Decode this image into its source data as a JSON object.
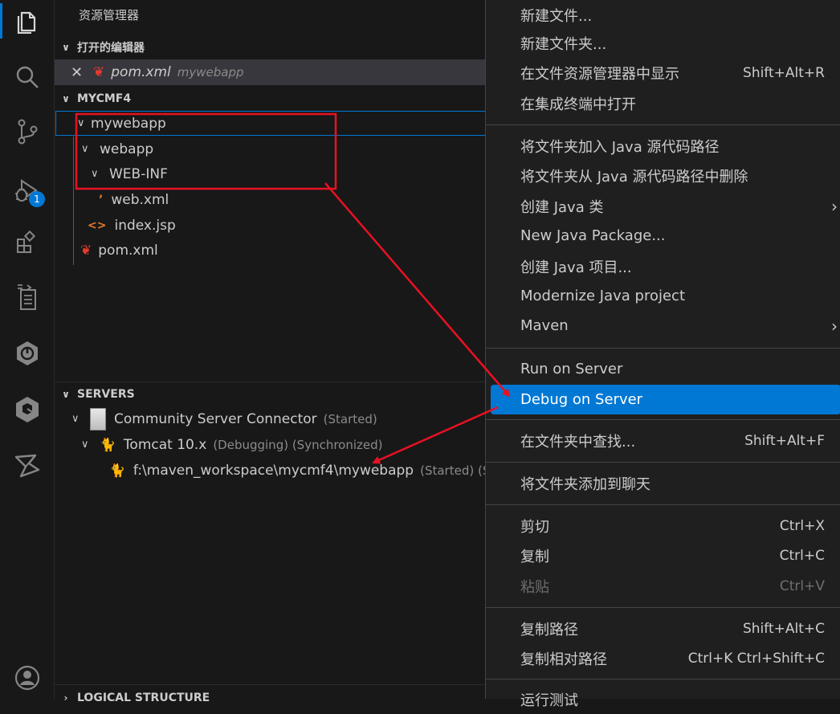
{
  "explorer_title": "资源管理器",
  "open_editors": {
    "header": "打开的编辑器",
    "item_name": "pom.xml",
    "item_folder": "mywebapp"
  },
  "workspace": {
    "header": "MYCMF4",
    "tree": {
      "mywebapp": "mywebapp",
      "webapp": "webapp",
      "webinf": "WEB-INF",
      "webxml": "web.xml",
      "indexjsp": "index.jsp",
      "pomxml": "pom.xml"
    }
  },
  "servers": {
    "header": "SERVERS",
    "connector": "Community Server Connector",
    "connector_state": "(Started)",
    "tomcat": "Tomcat 10.x",
    "tomcat_state": "(Debugging) (Synchronized)",
    "deployment": "f:\\maven_workspace\\mycmf4\\mywebapp",
    "deployment_state": "(Started) (Sy"
  },
  "bottom_section": "LOGICAL STRUCTURE",
  "activity": {
    "debug_badge": "1"
  },
  "menu": {
    "new_file": "新建文件...",
    "new_folder": "新建文件夹...",
    "reveal": "在文件资源管理器中显示",
    "reveal_key": "Shift+Alt+R",
    "open_terminal": "在集成终端中打开",
    "add_src": "将文件夹加入 Java 源代码路径",
    "remove_src": "将文件夹从 Java 源代码路径中删除",
    "create_class": "创建 Java 类",
    "new_package": "New Java Package...",
    "create_project": "创建 Java 项目...",
    "modernize": "Modernize Java project",
    "maven": "Maven",
    "run_server": "Run on Server",
    "debug_server": "Debug on Server",
    "find_in_folder": "在文件夹中查找...",
    "find_key": "Shift+Alt+F",
    "add_chat": "将文件夹添加到聊天",
    "cut": "剪切",
    "cut_key": "Ctrl+X",
    "copy": "复制",
    "copy_key": "Ctrl+C",
    "paste": "粘贴",
    "paste_key": "Ctrl+V",
    "copy_path": "复制路径",
    "copy_path_key": "Shift+Alt+C",
    "copy_rel_path": "复制相对路径",
    "copy_rel_key": "Ctrl+K Ctrl+Shift+C",
    "run_tests": "运行测试"
  },
  "colors": {
    "accent": "#0078d4",
    "annotation": "#e81123",
    "maven": "#e33b30"
  }
}
